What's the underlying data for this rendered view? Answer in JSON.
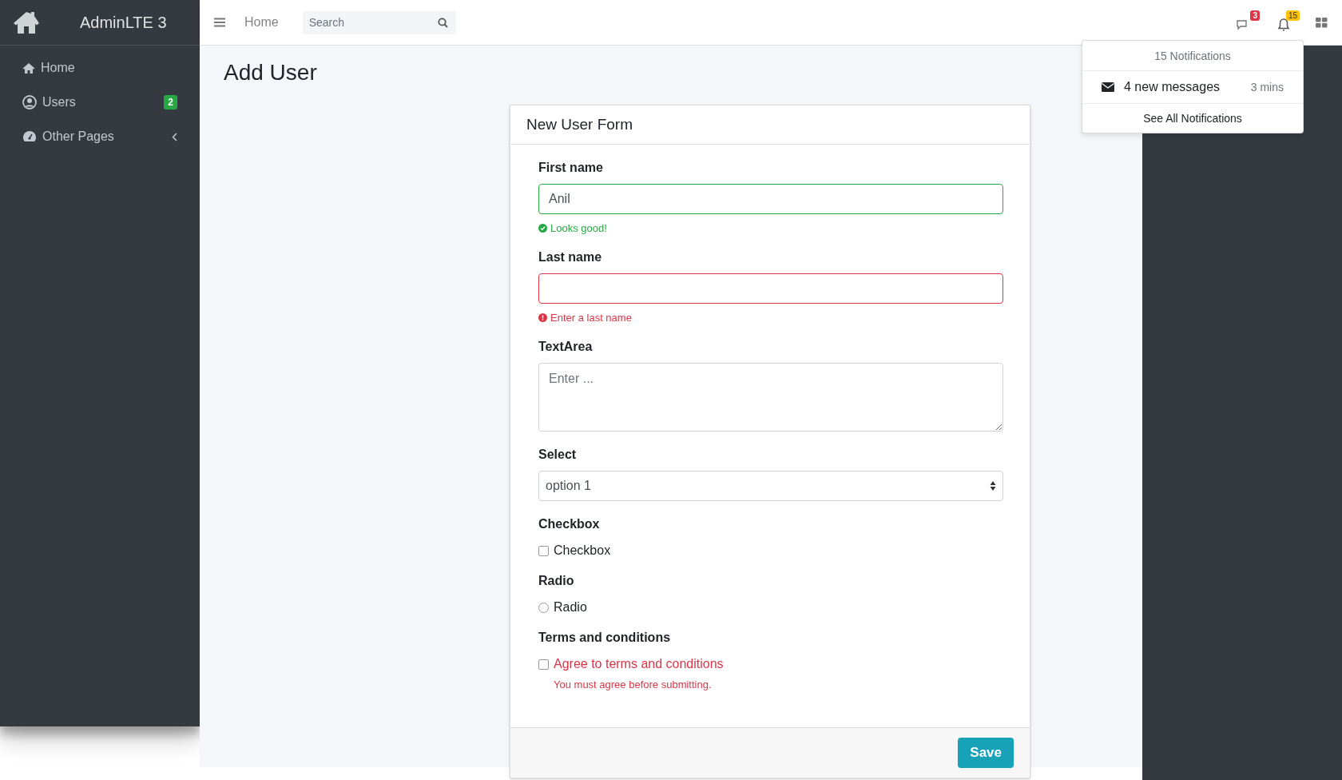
{
  "brand": {
    "title": "AdminLTE 3"
  },
  "sidebar": {
    "items": [
      {
        "label": "Home",
        "kind": "link"
      },
      {
        "label": "Users",
        "kind": "link",
        "badge": "2"
      },
      {
        "label": "Other Pages",
        "kind": "submenu"
      }
    ]
  },
  "navbar": {
    "link": "Home",
    "search": {
      "placeholder": "Search"
    },
    "badges": [
      {
        "kind": "chat",
        "count": "3",
        "color": "#dc3545"
      },
      {
        "kind": "bell",
        "count": "15",
        "color": "#ffc107"
      }
    ]
  },
  "notifications": {
    "header": "15 Notifications",
    "items": [
      {
        "text": "4 new messages",
        "time": "3 mins"
      }
    ],
    "footer": "See All Notifications"
  },
  "page_title": "Add User",
  "card": {
    "title": "New User Form",
    "fields": [
      {
        "kind": "text",
        "label": "First name",
        "value": "Anil",
        "invalid": false,
        "feedback": "Looks good!"
      },
      {
        "kind": "text",
        "label": "Last name",
        "invalid": true,
        "feedback": "Enter a last name"
      },
      {
        "kind": "textarea",
        "label": "TextArea",
        "placeholder": "Enter ..."
      },
      {
        "kind": "select",
        "label": "Select",
        "value": "option 1"
      },
      {
        "kind": "checkbox",
        "label": "Checkbox",
        "option": "Checkbox",
        "checked": false
      },
      {
        "kind": "radio",
        "label": "Radio",
        "option": "Radio",
        "selected": false
      },
      {
        "kind": "checkbox",
        "label": "Terms and conditions",
        "option": "Agree to terms and conditions",
        "checked": false,
        "invalid": true,
        "feedback": "You must agree before submitting."
      }
    ],
    "button": "Save"
  }
}
